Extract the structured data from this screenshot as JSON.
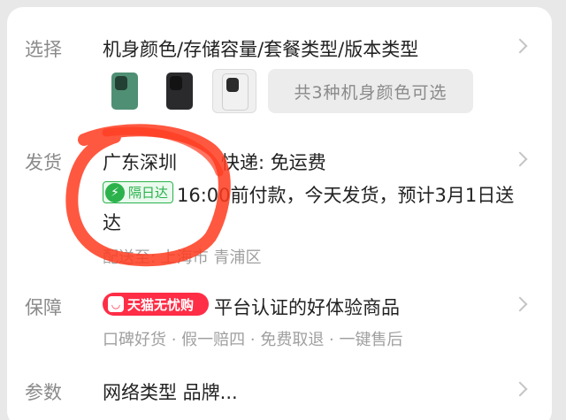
{
  "select_row": {
    "label": "选择",
    "title": "机身颜色/存储容量/套餐类型/版本类型",
    "colors": [
      {
        "name": "green-phone-icon",
        "color": "#4f8f74"
      },
      {
        "name": "black-phone-icon",
        "color": "#2a2a2c"
      },
      {
        "name": "white-phone-icon",
        "color": "#f1f1f1"
      }
    ],
    "colors_summary": "共3种机身颜色可选"
  },
  "shipping_row": {
    "label": "发货",
    "origin": "广东深圳",
    "express": "快递: 免运费",
    "badge": "隔日达",
    "delivery_line1": "16:00前付款，今天发货，预计3月1日送",
    "delivery_line2": "达",
    "destination": "配送至: 上海市 青浦区"
  },
  "guarantee_row": {
    "label": "保障",
    "badge": "天猫无忧购",
    "title": "平台认证的好体验商品",
    "items": "口碑好货 · 假一赔四 · 免费取退 · 一键售后"
  },
  "params_row": {
    "label": "参数",
    "title": "网络类型 品牌..."
  },
  "colors": {
    "accent_green": "#2bb24c",
    "accent_red": "#ff2d46",
    "annotation_red": "#ff3b1f"
  }
}
